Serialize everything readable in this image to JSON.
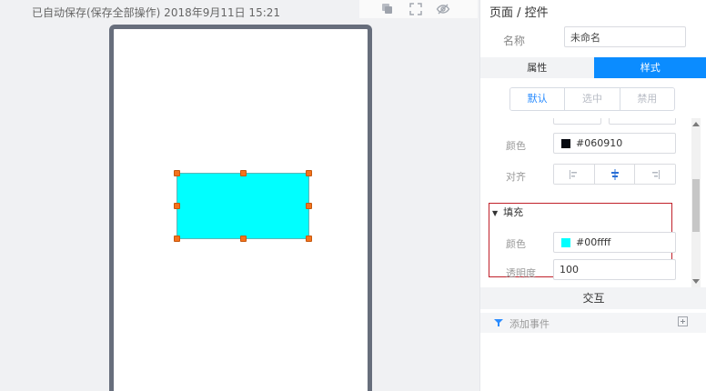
{
  "save_status": "已自动保存(保存全部操作) 2018年9月11日 15:21",
  "toolbar": {
    "icons": [
      "layers-icon",
      "fullscreen-icon",
      "hide-eye-icon"
    ]
  },
  "canvas": {
    "shape_color": "#00ffff",
    "handle_color": "#f5721b"
  },
  "panel": {
    "title": "页面 / 控件",
    "name_label": "名称",
    "name_value": "未命名",
    "tabs": [
      {
        "label": "属性",
        "active": false
      },
      {
        "label": "样式",
        "active": true
      }
    ],
    "states": [
      "默认",
      "选中",
      "禁用"
    ],
    "text_color_label": "颜色",
    "text_color_value": "#060910",
    "align_label": "对齐",
    "fill": {
      "title": "填充",
      "color_label": "颜色",
      "color_value": "#00ffff",
      "opacity_label": "透明度",
      "opacity_value": "100"
    },
    "interaction_title": "交互",
    "add_event_label": "添加事件"
  },
  "colors": {
    "accent": "#0b8cff",
    "highlight_border": "#c0202a"
  }
}
